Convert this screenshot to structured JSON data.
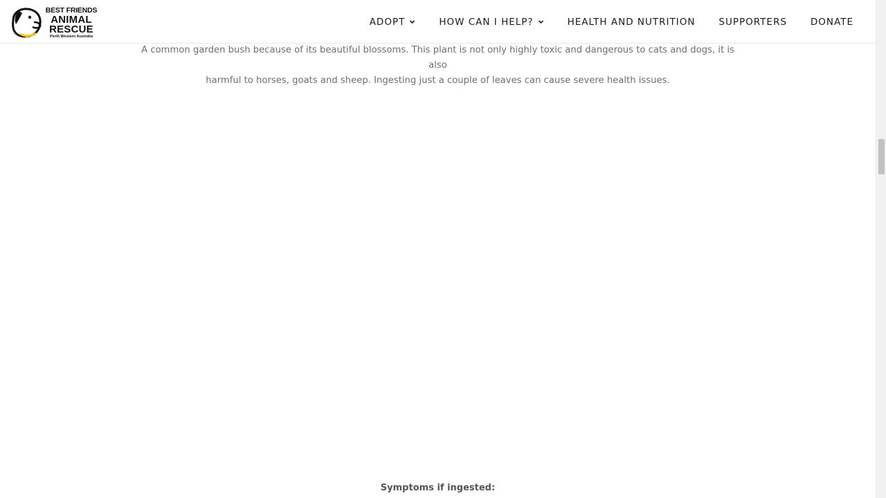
{
  "logo": {
    "line1": "BEST FRIENDS",
    "line2": "ANIMAL",
    "line3": "RESCUE",
    "line4": "Perth Western Australia",
    "icon": "dog-head-icon",
    "accent_color": "#f2c200"
  },
  "nav": {
    "items": [
      {
        "label": "ADOPT",
        "has_dropdown": true
      },
      {
        "label": "HOW CAN I HELP?",
        "has_dropdown": true
      },
      {
        "label": "HEALTH AND NUTRITION",
        "has_dropdown": false
      },
      {
        "label": "SUPPORTERS",
        "has_dropdown": false
      },
      {
        "label": "DONATE",
        "has_dropdown": false
      }
    ],
    "dropdown_icon": "chevron-down-icon"
  },
  "content": {
    "description_line1": "A common garden bush because of its beautiful blossoms. This plant is not only highly toxic and dangerous to cats and dogs, it is also",
    "description_line2": "harmful to horses, goats and sheep. Ingesting just a couple of leaves can cause severe health issues.",
    "symptoms_heading": "Symptoms if ingested:"
  },
  "scrollbar": {
    "position": 0.28
  }
}
